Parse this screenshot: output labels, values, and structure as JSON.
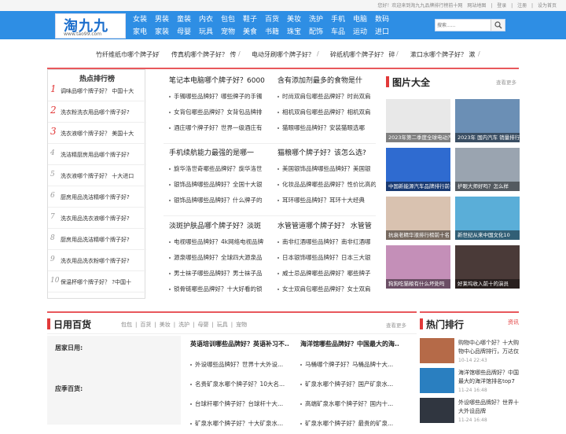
{
  "topbar": {
    "welcome": "您好！欢迎来到淘九九品牌排行榜前十网",
    "map": "网站地图",
    "login": "登录",
    "register": "注册",
    "home": "设为首页",
    "sep": "|"
  },
  "logo": {
    "name": "淘九九",
    "url": "www.tao99.com"
  },
  "nav": {
    "row1": [
      "女装",
      "男装",
      "童装",
      "内衣",
      "包包",
      "鞋子",
      "百货",
      "美妆",
      "洗护",
      "手机",
      "电脑",
      "数码"
    ],
    "row2": [
      "家电",
      "家装",
      "母婴",
      "玩具",
      "宠物",
      "美食",
      "书籍",
      "珠宝",
      "配饰",
      "车品",
      "运动",
      "进口"
    ]
  },
  "search": {
    "placeholder": "搜索......"
  },
  "hot_links": [
    "竹纤维纸巾哪个牌子好",
    "传真机哪个牌子好？ 传",
    "电动牙刷哪个牌子好？",
    "碎纸机哪个牌子好？ 碎",
    "漱口水哪个牌子好？ 漱"
  ],
  "hot_sep": "/",
  "rank": {
    "title": "热点排行榜",
    "items": [
      {
        "num": "1",
        "text": "调味品哪个牌子好？ 中国十大"
      },
      {
        "num": "2",
        "text": "洗衣粉洗衣用品哪个牌子好?"
      },
      {
        "num": "3",
        "text": "洗衣液哪个牌子好？ 美国十大"
      },
      {
        "num": "4",
        "text": "洗洁精厨房用品哪个牌子好?"
      },
      {
        "num": "5",
        "text": "洗衣液哪个牌子好？ 十大进口"
      },
      {
        "num": "6",
        "text": "厨房用品洗洁精哪个牌子好?"
      },
      {
        "num": "7",
        "text": "洗衣用品洗衣液哪个牌子好?"
      },
      {
        "num": "8",
        "text": "厨房用品洗洁精哪个牌子好?"
      },
      {
        "num": "9",
        "text": "洗衣用品洗衣粉哪个牌子好?"
      },
      {
        "num": "10",
        "text": "保温杯哪个牌子好？ ?中国十"
      }
    ]
  },
  "articles": [
    {
      "title": "笔记本电脑哪个牌子好？6000",
      "items": [
        "手镯哪些品牌好？哪些牌子的手镯",
        "女背包哪些品牌好？女背包品牌排",
        "酒庄哪个牌子好？世界一级酒庄有"
      ]
    },
    {
      "title": "含有添加剂最多的食物是什",
      "items": [
        "时尚双肩包哪些品牌好？时尚双肩",
        "相机双肩包哪些品牌好？相机双肩",
        "猫眼哪些品牌好？安装猫眼选哪"
      ]
    },
    {
      "title": "手机续航能力最强的是哪一",
      "items": [
        "旋华洛世奇哪些品牌好？旋华洛世",
        "银饰品牌哪些品牌好？全国十大银",
        "银饰品牌哪些品牌好？什么牌子的"
      ]
    },
    {
      "title": "猫粮哪个牌子好？该怎么选?",
      "items": [
        "美国银饰品牌哪些品牌好？美国银",
        "化妆品品牌哪些品牌好？性价比高的",
        "耳环哪些品牌好？耳环十大经典"
      ]
    },
    {
      "title": "淡斑护肤品哪个牌子好？淡斑",
      "items": [
        "电视哪些品牌好？4k网络电视品牌",
        "源泉哪些品牌好？全球四大源泉品",
        "男士袜子哪些品牌好？男士袜子品",
        "锁骨链哪些品牌好？十大好看的锁"
      ]
    },
    {
      "title": "水管管道哪个牌子好？ 水管管",
      "items": [
        "南非红酒哪些品牌好？南非红酒哪",
        "日本银饰哪些品牌好？日本三大银",
        "威士忌品牌哪些品牌好？哪些牌子",
        "女士双肩包哪些品牌好？女士双肩"
      ]
    }
  ],
  "pics": {
    "title": "图片大全",
    "more": "查看更多",
    "items": [
      {
        "caption": "2023年第二季度全球电动汽车...",
        "color": "#e8e8e8"
      },
      {
        "caption": "2023年 国内汽车 销量排行",
        "color": "#6b8fb5"
      },
      {
        "caption": "中国新能源汽车品牌排行前十",
        "color": "#2f6bd0"
      },
      {
        "caption": "护眼大师好吗？怎么样",
        "color": "#9aa4b0"
      },
      {
        "caption": "抗衰老精华液排行榜前十名",
        "color": "#d9c2b0"
      },
      {
        "caption": "新世纪从来中国文化10",
        "color": "#5aaed8"
      },
      {
        "caption": "狗狗吃猫粮有什么坏处吗",
        "color": "#c48fb8"
      },
      {
        "caption": "好莱坞收入前十的演员",
        "color": "#4a3a38"
      }
    ]
  },
  "daily": {
    "title": "日用百货",
    "tags": [
      "包包",
      "百货",
      "美妆",
      "洗护",
      "母婴",
      "玩具",
      "宠物"
    ],
    "tag_sep": "|",
    "more": "查看更多",
    "side": {
      "label1": "居家日用:",
      "label2": "应季百货:"
    },
    "col1": {
      "title": "英语培训哪些品牌好？英语补习不...",
      "items": [
        "外设哪些品牌好？世界十大外设...",
        "名贵矿泉水哪个牌子好？10大名...",
        "台球杆哪个牌子好？台球杆十大...",
        "矿泉水哪个牌子好？十大矿泉水..."
      ]
    },
    "col2": {
      "title": "海洋馆哪些品牌好？中国最大的海...",
      "items": [
        "马桶哪个牌子好？马桶品牌十大...",
        "矿泉水哪个牌子好？国产矿泉水...",
        "高端矿泉水哪个牌子好？国内十...",
        "矿泉水哪个牌子好？最贵的矿泉..."
      ]
    }
  },
  "hotrank": {
    "title": "热门排行",
    "more": "资讯",
    "items": [
      {
        "title": "购物中心哪个好？十大购物中心品牌排行，万达仅",
        "date": "10-14 22:43",
        "color": "#b56a48"
      },
      {
        "title": "海洋馆哪些品牌好？中国最大的海洋馆排名top7",
        "date": "11-24 16:48",
        "color": "#2a7fc0"
      },
      {
        "title": "外设哪些品牌好？世界十大外设品牌",
        "date": "11-24 16:48",
        "color": "#303640"
      }
    ]
  }
}
